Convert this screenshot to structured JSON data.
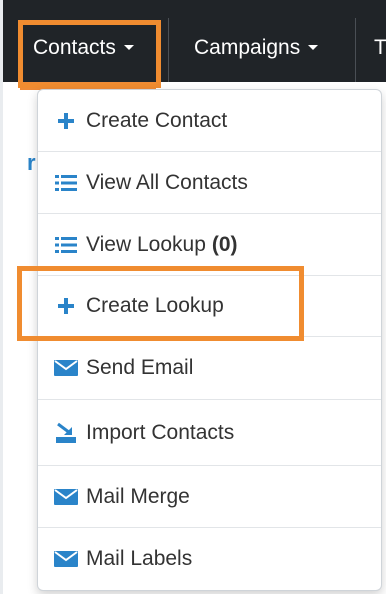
{
  "navbar": {
    "items": [
      {
        "label": "Contacts"
      },
      {
        "label": "Campaigns"
      },
      {
        "label": "T"
      }
    ]
  },
  "background": {
    "partial_text": "r"
  },
  "menu": {
    "items": [
      {
        "label": "Create Contact",
        "icon": "plus-icon"
      },
      {
        "label": "View All Contacts",
        "icon": "list-icon"
      },
      {
        "label": "View Lookup",
        "count": "(0)",
        "icon": "list-icon"
      },
      {
        "label": "Create Lookup",
        "icon": "plus-icon"
      },
      {
        "label": "Send Email",
        "icon": "envelope-icon"
      },
      {
        "label": "Import Contacts",
        "icon": "import-icon"
      },
      {
        "label": "Mail Merge",
        "icon": "envelope-icon"
      },
      {
        "label": "Mail Labels",
        "icon": "envelope-icon"
      }
    ]
  },
  "colors": {
    "navbar": "#202428",
    "highlight": "#f08c30",
    "icon_blue": "#2a84c9",
    "text": "#333333"
  }
}
